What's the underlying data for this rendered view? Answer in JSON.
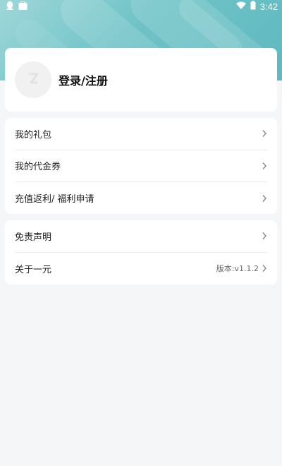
{
  "status_bar": {
    "time": "3:42",
    "icons": [
      "qq-icon",
      "bag-icon",
      "wifi-icon",
      "battery-icon"
    ]
  },
  "login": {
    "label": "登录/注册",
    "avatar_icon": "avatar-placeholder-icon"
  },
  "menu_group_1": [
    {
      "label": "我的礼包"
    },
    {
      "label": "我的代金券"
    },
    {
      "label": "充值返利/ 福利申请"
    }
  ],
  "menu_group_2": [
    {
      "label": "免责声明"
    },
    {
      "label": "关于一元",
      "extra": "版本:v1.1.2"
    }
  ],
  "colors": {
    "header_gradient_start": "#9fd7d9",
    "header_gradient_end": "#5fb9c0",
    "page_background": "#f5f6f8",
    "card_background": "#ffffff"
  }
}
